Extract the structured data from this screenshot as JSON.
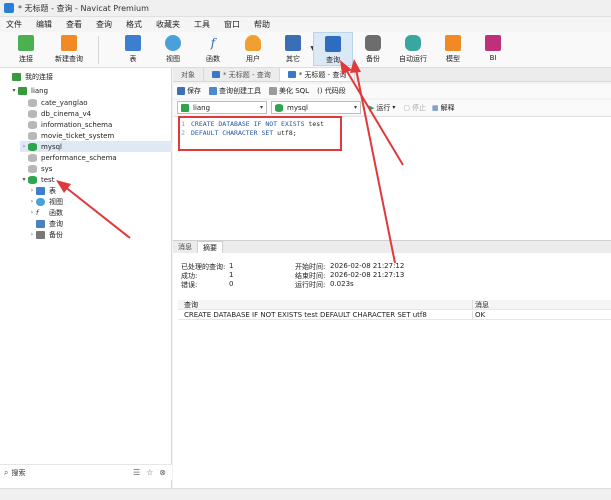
{
  "window": {
    "title": "* 无标题 - 查询 - Navicat Premium"
  },
  "menu": [
    "文件",
    "编辑",
    "查看",
    "查询",
    "格式",
    "收藏夹",
    "工具",
    "窗口",
    "帮助"
  ],
  "toolbar": {
    "connect": "连接",
    "new_query": "新建查询",
    "table": "表",
    "view": "视图",
    "function": "函数",
    "user": "用户",
    "other": "其它",
    "query": "查询",
    "backup": "备份",
    "automation": "自动运行",
    "model": "模型",
    "bi": "BI"
  },
  "sidebar": {
    "my_connections": "我的连接",
    "connection": "liang",
    "databases": [
      "cate_yanglao",
      "db_cinema_v4",
      "information_schema",
      "movie_ticket_system",
      "mysql",
      "performance_schema",
      "sys",
      "test"
    ],
    "test_children": [
      "表",
      "视图",
      "函数",
      "查询",
      "备份"
    ],
    "search_label": "搜索"
  },
  "tabs": {
    "objects": "对象",
    "tab1": "* 无标题 - 查询",
    "tab2": "* 无标题 - 查询"
  },
  "query_toolbar": {
    "save": "保存",
    "builder": "查询创建工具",
    "beautify": "美化 SQL",
    "snippet": "() 代码段"
  },
  "selectors": {
    "connection": "liang",
    "database": "mysql",
    "run": "运行",
    "stop": "停止",
    "explain": "解释"
  },
  "editor": {
    "lines": [
      {
        "num": "1",
        "kw": "CREATE DATABASE IF NOT EXISTS",
        "txt": " test"
      },
      {
        "num": "2",
        "kw": "DEFAULT CHARACTER SET",
        "txt": " utf8;"
      }
    ]
  },
  "results_tabs": {
    "message": "消息",
    "summary": "摘要"
  },
  "summary": {
    "processed_label": "已处理的查询:",
    "processed_value": "1",
    "success_label": "成功:",
    "success_value": "1",
    "error_label": "错误:",
    "error_value": "0",
    "start_label": "开始时间:",
    "start_value": "2026-02-08 21:27:12",
    "end_label": "结束时间:",
    "end_value": "2026-02-08 21:27:13",
    "runtime_label": "运行时间:",
    "runtime_value": "0.023s"
  },
  "results_table": {
    "col_query": "查询",
    "col_message": "消息",
    "row_query": "CREATE DATABASE IF NOT EXISTS test DEFAULT CHARACTER SET utf8",
    "row_message": "OK"
  },
  "colors": {
    "accent": "#2a7fd8",
    "annotation_red": "#e0393c"
  }
}
